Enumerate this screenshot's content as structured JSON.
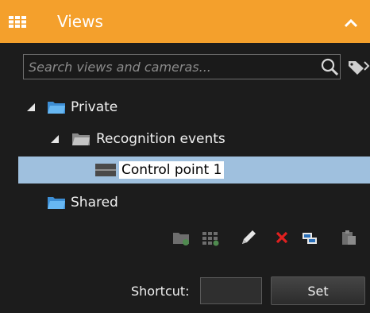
{
  "header": {
    "title": "Views",
    "icon": "grid-icon",
    "collapse_icon": "chevron-up-icon",
    "color": "#f4a02c"
  },
  "search": {
    "placeholder": "Search views and cameras...",
    "value": ""
  },
  "tree": {
    "private_label": "Private",
    "recognition_label": "Recognition events",
    "control_point_label": "Control point 1",
    "shared_label": "Shared"
  },
  "toolbar": {
    "icons": [
      "new-folder-icon",
      "new-view-icon",
      "edit-icon",
      "delete-icon",
      "copy-icon",
      "paste-icon"
    ]
  },
  "shortcut": {
    "label": "Shortcut:",
    "value": "",
    "set_label": "Set"
  },
  "colors": {
    "selection": "#9fc0de",
    "folder": "#4da6e8",
    "delete": "#e0201f"
  }
}
